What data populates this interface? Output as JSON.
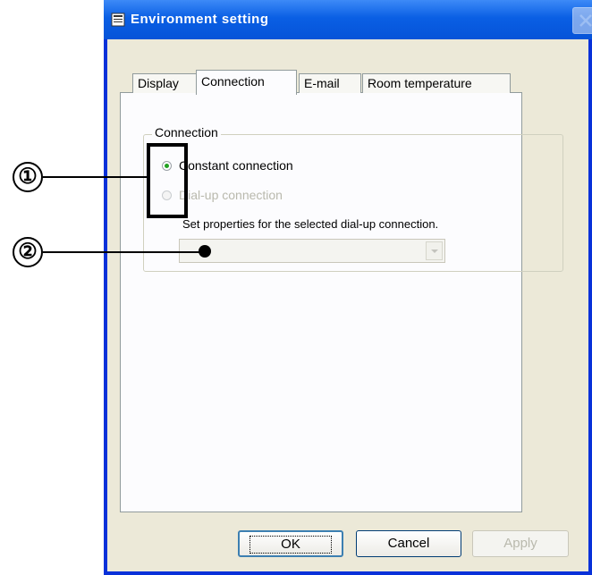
{
  "window": {
    "title": "Environment setting"
  },
  "tabs": [
    {
      "label": "Display"
    },
    {
      "label": "Connection"
    },
    {
      "label": "E-mail"
    },
    {
      "label": "Room temperature"
    }
  ],
  "connection_group": {
    "label": "Connection",
    "constant_connection": "Constant connection",
    "dialup_connection": "Dial-up connection",
    "dialup_hint": "Set properties for the selected dial-up connection.",
    "dialup_combo_value": ""
  },
  "buttons": {
    "ok": "OK",
    "cancel": "Cancel",
    "apply": "Apply"
  },
  "annotations": {
    "callout_1": "①",
    "callout_2": "②"
  }
}
